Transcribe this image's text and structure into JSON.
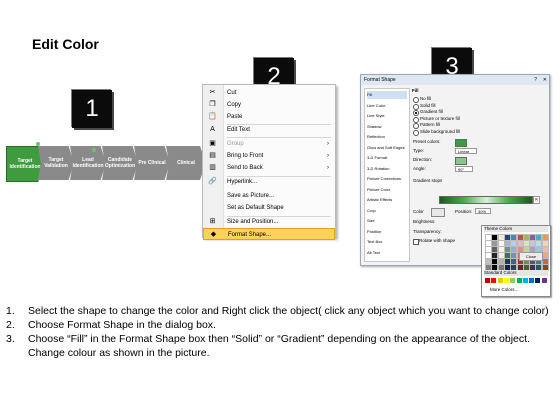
{
  "title": "Edit Color",
  "badges": [
    "1",
    "2",
    "3"
  ],
  "process": [
    "Target Identification",
    "Target Validation",
    "Lead Identification",
    "Candidate Optimization",
    "Pre Clinical",
    "Clinical"
  ],
  "context_menu": {
    "items": [
      {
        "label": "Cut",
        "icon": "scissors-icon",
        "glyph": "✂",
        "disabled": false
      },
      {
        "label": "Copy",
        "icon": "copy-icon",
        "glyph": "❐",
        "disabled": false
      },
      {
        "label": "Paste",
        "icon": "paste-icon",
        "glyph": "📋",
        "disabled": false
      },
      {
        "label": "Edit Text",
        "icon": "edit-text-icon",
        "glyph": "A",
        "disabled": false
      },
      {
        "label": "Group",
        "icon": "group-icon",
        "glyph": "▣",
        "disabled": true,
        "submenu": true
      },
      {
        "label": "Bring to Front",
        "icon": "bring-front-icon",
        "glyph": "▤",
        "disabled": false,
        "submenu": true
      },
      {
        "label": "Send to Back",
        "icon": "send-back-icon",
        "glyph": "▥",
        "disabled": false,
        "submenu": true
      },
      {
        "label": "Hyperlink...",
        "icon": "hyperlink-icon",
        "glyph": "🔗",
        "disabled": false
      },
      {
        "label": "Save as Picture...",
        "icon": "",
        "glyph": "",
        "disabled": false
      },
      {
        "label": "Set as Default Shape",
        "icon": "",
        "glyph": "",
        "disabled": false
      },
      {
        "label": "Size and Position...",
        "icon": "size-icon",
        "glyph": "⊞",
        "disabled": false
      },
      {
        "label": "Format Shape...",
        "icon": "format-shape-icon",
        "glyph": "◆",
        "disabled": false,
        "selected": true
      }
    ]
  },
  "dialog": {
    "title": "Format Shape",
    "help": "?",
    "close": "✕",
    "nav": [
      "Fill",
      "Line Color",
      "Line Style",
      "Shadow",
      "Reflection",
      "Glow and Soft Edges",
      "3-D Format",
      "3-D Rotation",
      "Picture Corrections",
      "Picture Color",
      "Artistic Effects",
      "Crop",
      "Size",
      "Position",
      "Text Box",
      "Alt Text"
    ],
    "section": "Fill",
    "fill_options": [
      "No fill",
      "Solid fill",
      "Gradient fill",
      "Picture or texture fill",
      "Pattern fill",
      "Slide background fill"
    ],
    "preset_colors_label": "Preset colors:",
    "type_label": "Type:",
    "type_value": "Linear",
    "direction_label": "Direction:",
    "angle_label": "Angle:",
    "angle_value": "90°",
    "gradient_stops_label": "Gradient stops",
    "color_label": "Color",
    "position_label": "Position:",
    "position_value": "30%",
    "brightness_label": "Brightness:",
    "transparency_label": "Transparency:",
    "rotate_label": "Rotate with shape",
    "theme_colors_label": "Theme Colors",
    "standard_colors_label": "Standard Colors",
    "more_colors_label": "More Colors...",
    "close_button": "Close"
  },
  "steps": [
    {
      "num": "1.",
      "text": "Select the shape to change the color and Right click the object( click any object which you want to change color)"
    },
    {
      "num": "2.",
      "text": "Choose Format Shape in the dialog box."
    },
    {
      "num": "3.",
      "text": "Choose “Fill” in the Format Shape box then “Solid” or “Gradient” depending on the appearance of the object. Change colour as shown in the picture."
    }
  ],
  "colors": {
    "accent_green": "#3e9c3e",
    "chevron_grey": "#8a8a8a",
    "menu_highlight": "#ffd25a",
    "badge_black": "#0b0b0b"
  }
}
